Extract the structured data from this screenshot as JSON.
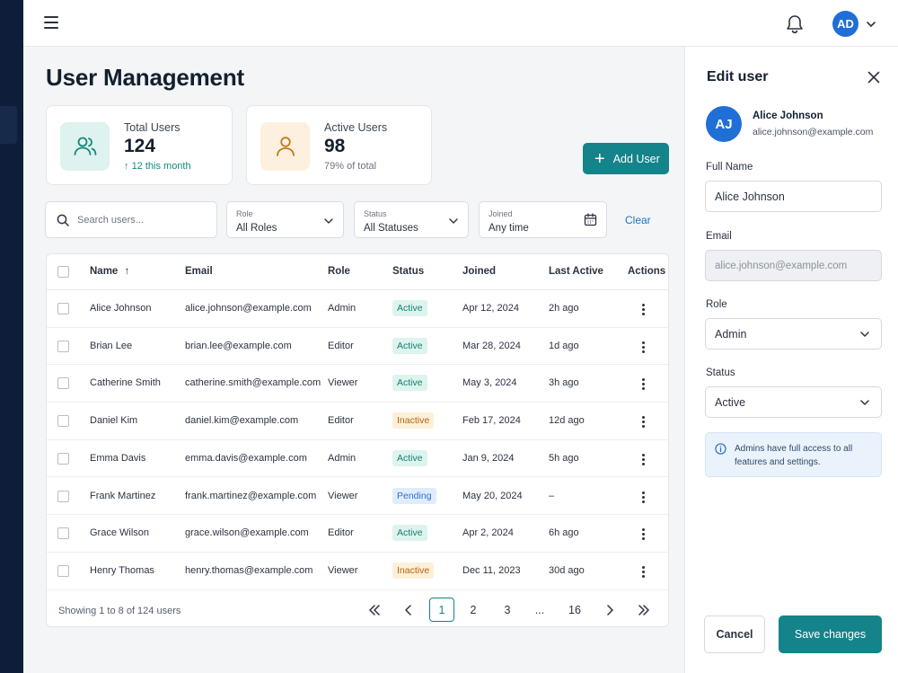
{
  "topbar": {
    "avatar_initials": "AD"
  },
  "page_title": "User Management",
  "stats": [
    {
      "label": "Total Users",
      "value": "124",
      "sub": "12 this month",
      "icon": "users-icon",
      "icon_bg": "#def2ef",
      "icon_color": "#16897d"
    },
    {
      "label": "Active Users",
      "value": "98",
      "sub": "79% of total",
      "icon": "user-icon",
      "icon_bg": "#fdf0de",
      "icon_color": "#c27a1a"
    }
  ],
  "add_user_label": "Add User",
  "filters": {
    "search_placeholder": "Search users...",
    "role": {
      "label": "Role",
      "value": "All Roles"
    },
    "status": {
      "label": "Status",
      "value": "All Statuses"
    },
    "joined": {
      "label": "Joined",
      "value": "Any time"
    },
    "clear_label": "Clear"
  },
  "table": {
    "columns": [
      "Name",
      "Email",
      "Role",
      "Status",
      "Joined",
      "Last Active",
      "Actions"
    ],
    "rows": [
      {
        "name": "Alice Johnson",
        "email": "alice.johnson@example.com",
        "role": "Admin",
        "status": "Active",
        "joined": "Apr 12, 2024",
        "last_active": "2h ago"
      },
      {
        "name": "Brian Lee",
        "email": "brian.lee@example.com",
        "role": "Editor",
        "status": "Active",
        "joined": "Mar 28, 2024",
        "last_active": "1d ago"
      },
      {
        "name": "Catherine Smith",
        "email": "catherine.smith@example.com",
        "role": "Viewer",
        "status": "Active",
        "joined": "May 3, 2024",
        "last_active": "3h ago"
      },
      {
        "name": "Daniel Kim",
        "email": "daniel.kim@example.com",
        "role": "Editor",
        "status": "Inactive",
        "joined": "Feb 17, 2024",
        "last_active": "12d ago"
      },
      {
        "name": "Emma Davis",
        "email": "emma.davis@example.com",
        "role": "Admin",
        "status": "Active",
        "joined": "Jan 9, 2024",
        "last_active": "5h ago"
      },
      {
        "name": "Frank Martinez",
        "email": "frank.martinez@example.com",
        "role": "Viewer",
        "status": "Pending",
        "joined": "May 20, 2024",
        "last_active": "–"
      },
      {
        "name": "Grace Wilson",
        "email": "grace.wilson@example.com",
        "role": "Editor",
        "status": "Active",
        "joined": "Apr 2, 2024",
        "last_active": "6h ago"
      },
      {
        "name": "Henry Thomas",
        "email": "henry.thomas@example.com",
        "role": "Viewer",
        "status": "Inactive",
        "joined": "Dec 11, 2023",
        "last_active": "30d ago"
      }
    ]
  },
  "pagination": {
    "info": "Showing 1 to 8 of 124 users",
    "pages": [
      "1",
      "2",
      "3",
      "...",
      "16"
    ],
    "current": "1"
  },
  "edit_panel": {
    "title": "Edit user",
    "avatar_initials": "AJ",
    "name": "Alice Johnson",
    "email": "alice.johnson@example.com",
    "full_name_label": "Full Name",
    "full_name_value": "Alice Johnson",
    "email_label": "Email",
    "email_value": "alice.johnson@example.com",
    "role_label": "Role",
    "role_value": "Admin",
    "status_label": "Status",
    "status_value": "Active",
    "info_text": "Admins have full access to all features and settings.",
    "cancel_label": "Cancel",
    "save_label": "Save changes"
  },
  "colors": {
    "accent": "#14838a",
    "nav_bg": "#0e1e3a",
    "avatar_blue": "#1f6fd6",
    "link": "#1777c2"
  }
}
